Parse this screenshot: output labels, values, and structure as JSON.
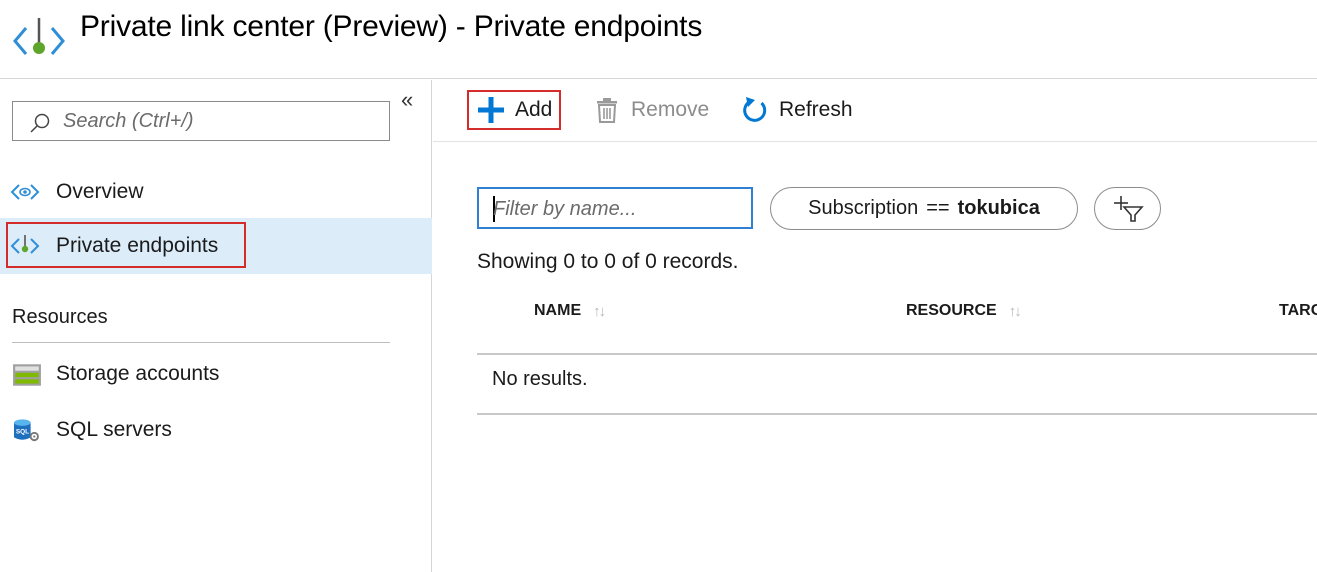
{
  "header": {
    "title": "Private link center (Preview) - Private endpoints",
    "icon": "private-link-icon"
  },
  "sidebar": {
    "search": {
      "placeholder": "Search (Ctrl+/)",
      "value": ""
    },
    "collapse_glyph": "«",
    "items": [
      {
        "label": "Overview",
        "icon": "overview-icon",
        "selected": false
      },
      {
        "label": "Private endpoints",
        "icon": "private-endpoint-icon",
        "selected": true
      }
    ],
    "resources_section": {
      "title": "Resources",
      "items": [
        {
          "label": "Storage accounts",
          "icon": "storage-account-icon"
        },
        {
          "label": "SQL servers",
          "icon": "sql-server-icon"
        }
      ]
    }
  },
  "toolbar": {
    "add_label": "Add",
    "remove_label": "Remove",
    "refresh_label": "Refresh"
  },
  "filters": {
    "name_placeholder": "Filter by name...",
    "name_value": "",
    "subscription": {
      "field": "Subscription",
      "operator": "==",
      "value": "tokubica"
    }
  },
  "results": {
    "summary": "Showing 0 to 0 of 0 records.",
    "columns": [
      "NAME",
      "RESOURCE",
      "TARG"
    ],
    "sort_glyph": "↑↓",
    "empty_message": "No results."
  },
  "colors": {
    "accent_blue": "#0078d4",
    "icon_green": "#5ea52b",
    "highlight_red": "#d42b2b",
    "selected_bg": "#dcecf9"
  }
}
